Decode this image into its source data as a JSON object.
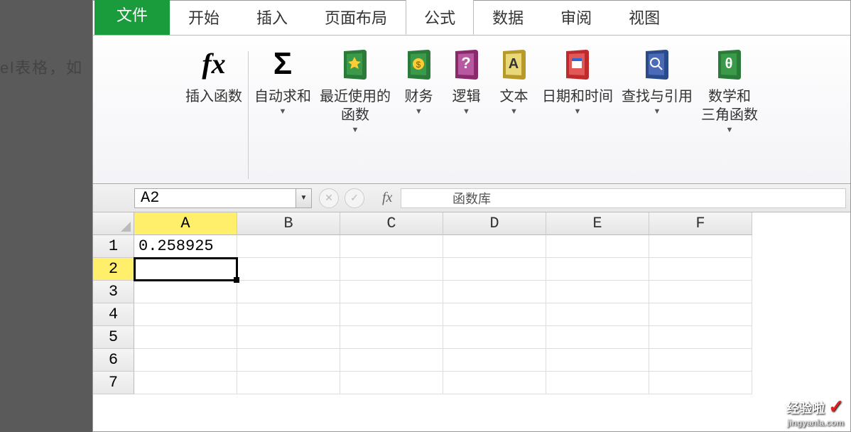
{
  "bg_text": "el表格，如",
  "tabs": {
    "file": "文件",
    "home": "开始",
    "insert": "插入",
    "layout": "页面布局",
    "formula": "公式",
    "data": "数据",
    "review": "审阅",
    "view": "视图"
  },
  "ribbon": {
    "insert_fn": "插入函数",
    "autosum": "自动求和",
    "recent": "最近使用的\n函数",
    "financial": "财务",
    "logical": "逻辑",
    "text": "文本",
    "datetime": "日期和时间",
    "lookup": "查找与引用",
    "math": "数学和\n三角函数",
    "group_label": "函数库"
  },
  "namebox": "A2",
  "fx_symbol": "fx",
  "columns": [
    "A",
    "B",
    "C",
    "D",
    "E",
    "F"
  ],
  "rows": [
    "1",
    "2",
    "3",
    "4",
    "5",
    "6",
    "7"
  ],
  "cells": {
    "A1": "0.258925"
  },
  "selected_cell": "A2",
  "watermark": {
    "main": "经验啦",
    "sub": "jingyanla.com"
  }
}
